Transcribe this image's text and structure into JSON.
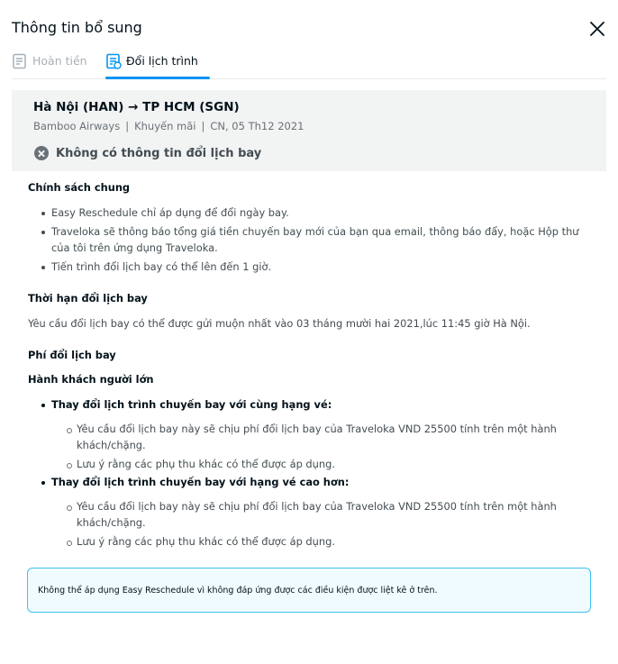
{
  "dialog": {
    "title": "Thông tin bổ sung",
    "close_icon": "close-icon"
  },
  "tabs": [
    {
      "label": "Hoàn tiền",
      "icon": "refund-document-icon",
      "active": false
    },
    {
      "label": "Đổi lịch trình",
      "icon": "reschedule-document-icon",
      "active": true
    }
  ],
  "flight": {
    "route": "Hà Nội (HAN) → TP HCM (SGN)",
    "airline": "Bamboo Airways",
    "fare": "Khuyến mãi",
    "date": "CN, 05 Th12 2021",
    "separator": "|",
    "status": "Không có thông tin đổi lịch bay",
    "status_icon": "x-circle-icon"
  },
  "policy": {
    "general_title": "Chính sách chung",
    "general_items": [
      "Easy Reschedule chỉ áp dụng để đổi ngày bay.",
      "Traveloka sẽ thông báo tổng giá tiền chuyến bay mới của bạn qua email, thông báo đẩy, hoặc Hộp thư của tôi trên ứng dụng Traveloka.",
      "Tiến trình đổi lịch bay có thể lên đến 1 giờ."
    ],
    "deadline_title": "Thời hạn đổi lịch bay",
    "deadline_text": "Yêu cầu đổi lịch bay có thể được gửi muộn nhất vào 03 tháng mười hai 2021,lúc 11:45 giờ Hà Nội.",
    "fee_title": "Phí đổi lịch bay",
    "adult_title": "Hành khách người lớn",
    "same_class_title": "Thay đổi lịch trình chuyến bay với cùng hạng vé:",
    "same_class_items": [
      "Yêu cầu đổi lịch bay này sẽ chịu phí đổi lịch bay của Traveloka VND 25500 tính trên một hành khách/chặng.",
      "Lưu ý rằng các phụ thu khác có thể được áp dụng."
    ],
    "higher_class_title": "Thay đổi lịch trình chuyến bay với hạng vé cao hơn:",
    "higher_class_items": [
      "Yêu cầu đổi lịch bay này sẽ chịu phí đổi lịch bay của Traveloka VND 25500 tính trên một hành khách/chặng.",
      "Lưu ý rằng các phụ thu khác có thể được áp dụng."
    ]
  },
  "notice": "Không thể áp dụng Easy Reschedule vì không đáp ứng được các điều kiện được liệt kê ở trên.",
  "colors": {
    "accent": "#0194f3",
    "notice_border": "#40c2ee",
    "notice_bg": "#effbff",
    "box_bg": "#f2f3f3"
  }
}
